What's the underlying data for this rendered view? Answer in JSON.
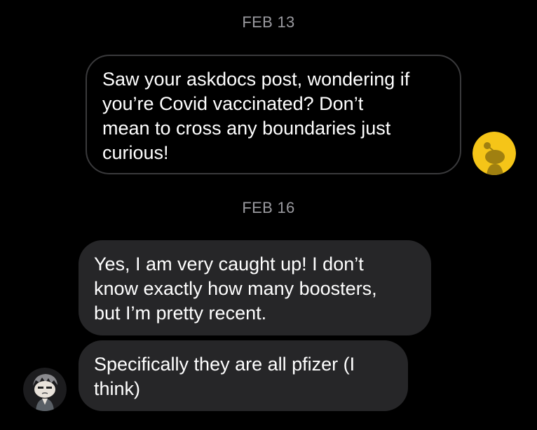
{
  "conversation": {
    "groups": [
      {
        "date": "FEB 13"
      },
      {
        "date": "FEB 16"
      }
    ],
    "messages": [
      {
        "sender": "self",
        "text": "Saw your askdocs post, wondering if\nyou’re Covid vaccinated? Don’t\nmean to cross any boundaries just\ncurious!"
      },
      {
        "sender": "other",
        "text": "Yes, I am very caught up! I don’t\nknow exactly how many boosters,\nbut I’m pretty recent."
      },
      {
        "sender": "other",
        "text": "Specifically they are all pfizer (I\nthink)"
      }
    ]
  },
  "avatars": {
    "self": {
      "icon": "snoo-avatar-icon",
      "color": "#f5c518"
    },
    "other": {
      "icon": "snoo-character-avatar-icon",
      "color": "#1c1c1e"
    }
  },
  "colors": {
    "background": "#000000",
    "self_bubble_border": "#3a3a3c",
    "other_bubble_fill": "#262628",
    "date_text": "#9a9a9f"
  }
}
